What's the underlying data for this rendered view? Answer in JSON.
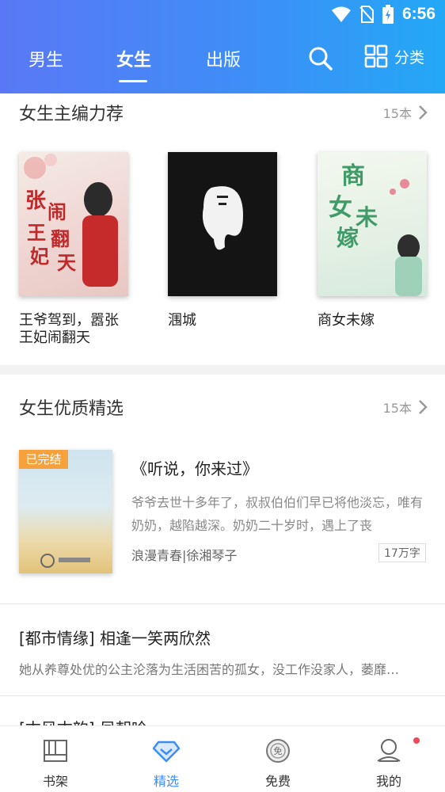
{
  "status": {
    "time": "6:56"
  },
  "tabs": [
    {
      "label": "男生"
    },
    {
      "label": "女生"
    },
    {
      "label": "出版"
    }
  ],
  "header": {
    "category_label": "分类"
  },
  "section1": {
    "title": "女生主编力荐",
    "count": "15本",
    "books": [
      {
        "title": "王爷驾到，嚣张王妃闹翻天"
      },
      {
        "title": "涠城"
      },
      {
        "title": "商女未嫁"
      }
    ]
  },
  "section2": {
    "title": "女生优质精选",
    "count": "15本",
    "featured": {
      "badge": "已完结",
      "title": "《听说，你来过》",
      "desc": "爷爷去世十多年了，叔叔伯伯们早已将他淡忘，唯有奶奶，越陷越深。奶奶二十岁时，遇上了丧",
      "meta": "浪漫青春|徐湘琴子",
      "words": "17万字"
    },
    "items": [
      {
        "title": "[都市情缘] 相逢一笑两欣然",
        "desc": "她从养尊处优的公主沦落为生活困苦的孤女，没工作没家人，萎靡…"
      },
      {
        "title": "[古风古韵] 凤朝吟"
      }
    ]
  },
  "bottom_nav": [
    {
      "label": "书架"
    },
    {
      "label": "精选"
    },
    {
      "label": "免费"
    },
    {
      "label": "我的"
    }
  ],
  "colors": {
    "accent": "#3c8ef5",
    "badge": "#f6a13b",
    "notify_dot": "#f0495a"
  }
}
